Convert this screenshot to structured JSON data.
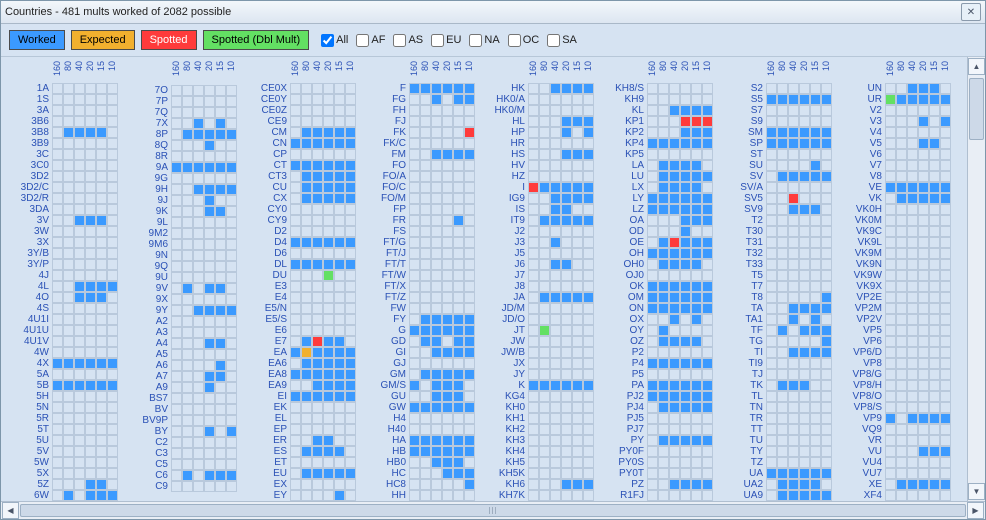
{
  "title": "Countries - 481 mults worked of 2082 possible",
  "legend": {
    "worked": "Worked",
    "expected": "Expected",
    "spotted": "Spotted",
    "dblmult": "Spotted (Dbl Mult)"
  },
  "filters": [
    {
      "label": "All",
      "checked": true
    },
    {
      "label": "AF",
      "checked": false
    },
    {
      "label": "AS",
      "checked": false
    },
    {
      "label": "EU",
      "checked": false
    },
    {
      "label": "NA",
      "checked": false
    },
    {
      "label": "OC",
      "checked": false
    },
    {
      "label": "SA",
      "checked": false
    }
  ],
  "bands": [
    "160",
    "80",
    "40",
    "20",
    "15",
    "10"
  ],
  "columns": [
    [
      {
        "p": "1A",
        "c": "eeeeee"
      },
      {
        "p": "1S",
        "c": "eeeeee"
      },
      {
        "p": "3A",
        "c": "eeeeee"
      },
      {
        "p": "3B6",
        "c": "eeeeee"
      },
      {
        "p": "3B8",
        "c": "eWWWWe"
      },
      {
        "p": "3B9",
        "c": "eeeeee"
      },
      {
        "p": "3C",
        "c": "eeeeee"
      },
      {
        "p": "3C0",
        "c": "eeeeee"
      },
      {
        "p": "3D2",
        "c": "eeeeee"
      },
      {
        "p": "3D2/C",
        "c": "eeeeee"
      },
      {
        "p": "3D2/R",
        "c": "eeeeee"
      },
      {
        "p": "3DA",
        "c": "eeeeee"
      },
      {
        "p": "3V",
        "c": "eeWWWe"
      },
      {
        "p": "3W",
        "c": "eeeeee"
      },
      {
        "p": "3X",
        "c": "eeeeee"
      },
      {
        "p": "3Y/B",
        "c": "eeeeee"
      },
      {
        "p": "3Y/P",
        "c": "eeeeee"
      },
      {
        "p": "4J",
        "c": "eeeeee"
      },
      {
        "p": "4L",
        "c": "eeWWWW"
      },
      {
        "p": "4O",
        "c": "eeWWWe"
      },
      {
        "p": "4S",
        "c": "eeeeee"
      },
      {
        "p": "4U1I",
        "c": "eeeeee"
      },
      {
        "p": "4U1U",
        "c": "eeeeee"
      },
      {
        "p": "4U1V",
        "c": "eeeeee"
      },
      {
        "p": "4W",
        "c": "eeeeee"
      },
      {
        "p": "4X",
        "c": "WWWWWW"
      },
      {
        "p": "5A",
        "c": "eeeeee"
      },
      {
        "p": "5B",
        "c": "WWWWWW"
      },
      {
        "p": "5H",
        "c": "eeeeee"
      },
      {
        "p": "5N",
        "c": "eeeeee"
      },
      {
        "p": "5R",
        "c": "eeeeee"
      },
      {
        "p": "5T",
        "c": "eeeeee"
      },
      {
        "p": "5U",
        "c": "eeeeee"
      },
      {
        "p": "5V",
        "c": "eeeeee"
      },
      {
        "p": "5W",
        "c": "eeeeee"
      },
      {
        "p": "5X",
        "c": "eeeeee"
      },
      {
        "p": "5Z",
        "c": "eeeWWe"
      },
      {
        "p": "6W",
        "c": "eWeWWW"
      }
    ],
    [
      {
        "p": "7O",
        "c": "eeeeee"
      },
      {
        "p": "7P",
        "c": "eeeeee"
      },
      {
        "p": "7Q",
        "c": "eeeeee"
      },
      {
        "p": "7X",
        "c": "eeWeWe"
      },
      {
        "p": "8P",
        "c": "eWWWWW"
      },
      {
        "p": "8Q",
        "c": "eeeWee"
      },
      {
        "p": "8R",
        "c": "eeeeee"
      },
      {
        "p": "9A",
        "c": "WWWWWW"
      },
      {
        "p": "9G",
        "c": "eeeeee"
      },
      {
        "p": "9H",
        "c": "eeWWWW"
      },
      {
        "p": "9J",
        "c": "eeeWee"
      },
      {
        "p": "9K",
        "c": "eeeWWe"
      },
      {
        "p": "9L",
        "c": "eeeeee"
      },
      {
        "p": "9M2",
        "c": "eeeeee"
      },
      {
        "p": "9M6",
        "c": "eeeeee"
      },
      {
        "p": "9N",
        "c": "eeeeee"
      },
      {
        "p": "9Q",
        "c": "eeeeee"
      },
      {
        "p": "9U",
        "c": "eeeeee"
      },
      {
        "p": "9V",
        "c": "eWeWWe"
      },
      {
        "p": "9X",
        "c": "eeeeee"
      },
      {
        "p": "9Y",
        "c": "eeWWWW"
      },
      {
        "p": "A2",
        "c": "eeeeee"
      },
      {
        "p": "A3",
        "c": "eeeeee"
      },
      {
        "p": "A4",
        "c": "eeeWWe"
      },
      {
        "p": "A5",
        "c": "eeeeee"
      },
      {
        "p": "A6",
        "c": "eeeeWe"
      },
      {
        "p": "A7",
        "c": "eeeWWe"
      },
      {
        "p": "A9",
        "c": "eeeWee"
      },
      {
        "p": "BS7",
        "c": "eeeeee"
      },
      {
        "p": "BV",
        "c": "eeeeee"
      },
      {
        "p": "BV9P",
        "c": "eeeeee"
      },
      {
        "p": "BY",
        "c": "eeeWeW"
      },
      {
        "p": "C2",
        "c": "eeeeee"
      },
      {
        "p": "C3",
        "c": "eeeeee"
      },
      {
        "p": "C5",
        "c": "eeeeee"
      },
      {
        "p": "C6",
        "c": "eWeWWW"
      },
      {
        "p": "C9",
        "c": "eeeeee"
      }
    ],
    [
      {
        "p": "CE0X",
        "c": "eeeeee"
      },
      {
        "p": "CE0Y",
        "c": "eeeeee"
      },
      {
        "p": "CE0Z",
        "c": "eeeeee"
      },
      {
        "p": "CE9",
        "c": "eeeeee"
      },
      {
        "p": "CM",
        "c": "eWWWWW"
      },
      {
        "p": "CN",
        "c": "WWWWWW"
      },
      {
        "p": "CP",
        "c": "eeeeee"
      },
      {
        "p": "CT",
        "c": "WWWWWW"
      },
      {
        "p": "CT3",
        "c": "eWWWWW"
      },
      {
        "p": "CU",
        "c": "eWWWWW"
      },
      {
        "p": "CX",
        "c": "eWWWWW"
      },
      {
        "p": "CY0",
        "c": "eeeeee"
      },
      {
        "p": "CY9",
        "c": "eeeeee"
      },
      {
        "p": "D2",
        "c": "eeeeee"
      },
      {
        "p": "D4",
        "c": "WWWWWW"
      },
      {
        "p": "D6",
        "c": "eeeeee"
      },
      {
        "p": "DL",
        "c": "WWWWWW"
      },
      {
        "p": "DU",
        "c": "eeeDee"
      },
      {
        "p": "E3",
        "c": "eeeeee"
      },
      {
        "p": "E4",
        "c": "eeeeee"
      },
      {
        "p": "E5/N",
        "c": "eeeeee"
      },
      {
        "p": "E5/S",
        "c": "eeeeee"
      },
      {
        "p": "E6",
        "c": "eeeeee"
      },
      {
        "p": "E7",
        "c": "eWSWWe"
      },
      {
        "p": "EA",
        "c": "WXWWWW"
      },
      {
        "p": "EA6",
        "c": "eWWWWW"
      },
      {
        "p": "EA8",
        "c": "WWWWWW"
      },
      {
        "p": "EA9",
        "c": "eeWWWW"
      },
      {
        "p": "EI",
        "c": "WWWWWW"
      },
      {
        "p": "EK",
        "c": "eeeeee"
      },
      {
        "p": "EL",
        "c": "eeeeee"
      },
      {
        "p": "EP",
        "c": "eeeeee"
      },
      {
        "p": "ER",
        "c": "eeWWee"
      },
      {
        "p": "ES",
        "c": "eWWWWe"
      },
      {
        "p": "ET",
        "c": "eeeeee"
      },
      {
        "p": "EU",
        "c": "eWWWWW"
      },
      {
        "p": "EX",
        "c": "eeeeee"
      },
      {
        "p": "EY",
        "c": "eeeeWe"
      }
    ],
    [
      {
        "p": "F",
        "c": "WWWWWW"
      },
      {
        "p": "FG",
        "c": "eeWeWW"
      },
      {
        "p": "FH",
        "c": "eeeeee"
      },
      {
        "p": "FJ",
        "c": "eeeeee"
      },
      {
        "p": "FK",
        "c": "eeeeeS"
      },
      {
        "p": "FK/C",
        "c": "eeeeee"
      },
      {
        "p": "FM",
        "c": "eeWWWW"
      },
      {
        "p": "FO",
        "c": "eeeeee"
      },
      {
        "p": "FO/A",
        "c": "eeeeee"
      },
      {
        "p": "FO/C",
        "c": "eeeeee"
      },
      {
        "p": "FO/M",
        "c": "eeeeee"
      },
      {
        "p": "FP",
        "c": "eeeeee"
      },
      {
        "p": "FR",
        "c": "eeeeWe"
      },
      {
        "p": "FS",
        "c": "eeeeee"
      },
      {
        "p": "FT/G",
        "c": "eeeeee"
      },
      {
        "p": "FT/J",
        "c": "eeeeee"
      },
      {
        "p": "FT/T",
        "c": "eeeeee"
      },
      {
        "p": "FT/W",
        "c": "eeeeee"
      },
      {
        "p": "FT/X",
        "c": "eeeeee"
      },
      {
        "p": "FT/Z",
        "c": "eeeeee"
      },
      {
        "p": "FW",
        "c": "eeeeee"
      },
      {
        "p": "FY",
        "c": "eWWWWW"
      },
      {
        "p": "G",
        "c": "WWWWWW"
      },
      {
        "p": "GD",
        "c": "eWWeWW"
      },
      {
        "p": "GI",
        "c": "eeWWWW"
      },
      {
        "p": "GJ",
        "c": "eeeeee"
      },
      {
        "p": "GM",
        "c": "eWWWWW"
      },
      {
        "p": "GM/S",
        "c": "WeWWWe"
      },
      {
        "p": "GU",
        "c": "eeWWWe"
      },
      {
        "p": "GW",
        "c": "WWWWWW"
      },
      {
        "p": "H4",
        "c": "eeeeee"
      },
      {
        "p": "H40",
        "c": "eeeeee"
      },
      {
        "p": "HA",
        "c": "WWWWWW"
      },
      {
        "p": "HB",
        "c": "WWWWWW"
      },
      {
        "p": "HB0",
        "c": "eeWWWe"
      },
      {
        "p": "HC",
        "c": "eeeWWW"
      },
      {
        "p": "HC8",
        "c": "eeeeeW"
      },
      {
        "p": "HH",
        "c": "eeeeee"
      }
    ],
    [
      {
        "p": "HK",
        "c": "eeWWWW"
      },
      {
        "p": "HK0/A",
        "c": "eeeeee"
      },
      {
        "p": "HK0/M",
        "c": "eeeeee"
      },
      {
        "p": "HL",
        "c": "eeeWWW"
      },
      {
        "p": "HP",
        "c": "eeeWeW"
      },
      {
        "p": "HR",
        "c": "eeeeee"
      },
      {
        "p": "HS",
        "c": "eeeWWW"
      },
      {
        "p": "HV",
        "c": "eeeeee"
      },
      {
        "p": "HZ",
        "c": "eeeeee"
      },
      {
        "p": "I",
        "c": "SWWWWW"
      },
      {
        "p": "IG9",
        "c": "eeWWWW"
      },
      {
        "p": "IS",
        "c": "eeWWee"
      },
      {
        "p": "IT9",
        "c": "eWWWWW"
      },
      {
        "p": "J2",
        "c": "eeeeee"
      },
      {
        "p": "J3",
        "c": "eeWeee"
      },
      {
        "p": "J5",
        "c": "eeeeee"
      },
      {
        "p": "J6",
        "c": "eeWWee"
      },
      {
        "p": "J7",
        "c": "eeeeee"
      },
      {
        "p": "J8",
        "c": "eeeeee"
      },
      {
        "p": "JA",
        "c": "eWWWWW"
      },
      {
        "p": "JD/M",
        "c": "eeeeee"
      },
      {
        "p": "JD/O",
        "c": "eeeeee"
      },
      {
        "p": "JT",
        "c": "eDeeee"
      },
      {
        "p": "JW",
        "c": "eeeeee"
      },
      {
        "p": "JW/B",
        "c": "eeeeee"
      },
      {
        "p": "JX",
        "c": "eeeeee"
      },
      {
        "p": "JY",
        "c": "eeeeee"
      },
      {
        "p": "K",
        "c": "WWWWWW"
      },
      {
        "p": "KG4",
        "c": "eeeeee"
      },
      {
        "p": "KH0",
        "c": "eeeeee"
      },
      {
        "p": "KH1",
        "c": "eeeeee"
      },
      {
        "p": "KH2",
        "c": "eeeeee"
      },
      {
        "p": "KH3",
        "c": "eeeeee"
      },
      {
        "p": "KH4",
        "c": "eeeeee"
      },
      {
        "p": "KH5",
        "c": "eeeeee"
      },
      {
        "p": "KH5K",
        "c": "eeeeee"
      },
      {
        "p": "KH6",
        "c": "eeeWWW"
      },
      {
        "p": "KH7K",
        "c": "eeeeee"
      }
    ],
    [
      {
        "p": "KH8/S",
        "c": "eeeeee"
      },
      {
        "p": "KH9",
        "c": "eeeeee"
      },
      {
        "p": "KL",
        "c": "eeWWWW"
      },
      {
        "p": "KP1",
        "c": "eeeSSS"
      },
      {
        "p": "KP2",
        "c": "eeeWWW"
      },
      {
        "p": "KP4",
        "c": "WWWWWW"
      },
      {
        "p": "KP5",
        "c": "eeeeee"
      },
      {
        "p": "LA",
        "c": "eWWWWe"
      },
      {
        "p": "LU",
        "c": "eWWWWW"
      },
      {
        "p": "LX",
        "c": "eWWWWe"
      },
      {
        "p": "LY",
        "c": "WWWWWW"
      },
      {
        "p": "LZ",
        "c": "WWWWWW"
      },
      {
        "p": "OA",
        "c": "eeeWWW"
      },
      {
        "p": "OD",
        "c": "eeeWee"
      },
      {
        "p": "OE",
        "c": "eWSWWW"
      },
      {
        "p": "OH",
        "c": "WWWWWW"
      },
      {
        "p": "OH0",
        "c": "eWWWWe"
      },
      {
        "p": "OJ0",
        "c": "eeeeee"
      },
      {
        "p": "OK",
        "c": "WWWWWW"
      },
      {
        "p": "OM",
        "c": "WWWWWW"
      },
      {
        "p": "ON",
        "c": "WWWWWW"
      },
      {
        "p": "OX",
        "c": "eeWeWe"
      },
      {
        "p": "OY",
        "c": "eWeeee"
      },
      {
        "p": "OZ",
        "c": "eWWWWe"
      },
      {
        "p": "P2",
        "c": "eeeeee"
      },
      {
        "p": "P4",
        "c": "WWWWWW"
      },
      {
        "p": "P5",
        "c": "eeeeee"
      },
      {
        "p": "PA",
        "c": "WWWWWW"
      },
      {
        "p": "PJ2",
        "c": "WWWWWW"
      },
      {
        "p": "PJ4",
        "c": "eWWWWW"
      },
      {
        "p": "PJ5",
        "c": "eeeeee"
      },
      {
        "p": "PJ7",
        "c": "eeeeee"
      },
      {
        "p": "PY",
        "c": "eWWWWW"
      },
      {
        "p": "PY0F",
        "c": "eeeeee"
      },
      {
        "p": "PY0S",
        "c": "eeeeee"
      },
      {
        "p": "PY0T",
        "c": "eeeeee"
      },
      {
        "p": "PZ",
        "c": "eeWWWW"
      },
      {
        "p": "R1FJ",
        "c": "eeeeee"
      }
    ],
    [
      {
        "p": "S2",
        "c": "eeeeee"
      },
      {
        "p": "S5",
        "c": "WWWWWW"
      },
      {
        "p": "S7",
        "c": "eeeeee"
      },
      {
        "p": "S9",
        "c": "eeeeee"
      },
      {
        "p": "SM",
        "c": "WWWWWW"
      },
      {
        "p": "SP",
        "c": "WWWWWW"
      },
      {
        "p": "ST",
        "c": "eeeeee"
      },
      {
        "p": "SU",
        "c": "eeeeWe"
      },
      {
        "p": "SV",
        "c": "eWWWWW"
      },
      {
        "p": "SV/A",
        "c": "eeeeee"
      },
      {
        "p": "SV5",
        "c": "eeSeee"
      },
      {
        "p": "SV9",
        "c": "eeWWWe"
      },
      {
        "p": "T2",
        "c": "eeeeee"
      },
      {
        "p": "T30",
        "c": "eeeeee"
      },
      {
        "p": "T31",
        "c": "eeeeee"
      },
      {
        "p": "T32",
        "c": "eeeeee"
      },
      {
        "p": "T33",
        "c": "eeeeee"
      },
      {
        "p": "T5",
        "c": "eeeeee"
      },
      {
        "p": "T7",
        "c": "eeeeee"
      },
      {
        "p": "T8",
        "c": "eeeeeW"
      },
      {
        "p": "TA",
        "c": "eeWWWW"
      },
      {
        "p": "TA1",
        "c": "eeWeWe"
      },
      {
        "p": "TF",
        "c": "eWeWWW"
      },
      {
        "p": "TG",
        "c": "eeeeeW"
      },
      {
        "p": "TI",
        "c": "eeWWWW"
      },
      {
        "p": "TI9",
        "c": "eeeeee"
      },
      {
        "p": "TJ",
        "c": "eeeeee"
      },
      {
        "p": "TK",
        "c": "eWWWee"
      },
      {
        "p": "TL",
        "c": "eeeeee"
      },
      {
        "p": "TN",
        "c": "eeeeee"
      },
      {
        "p": "TR",
        "c": "eeeeee"
      },
      {
        "p": "TT",
        "c": "eeeeee"
      },
      {
        "p": "TU",
        "c": "eeeeee"
      },
      {
        "p": "TY",
        "c": "eeeeee"
      },
      {
        "p": "TZ",
        "c": "eeeeee"
      },
      {
        "p": "UA",
        "c": "WWWWWW"
      },
      {
        "p": "UA2",
        "c": "eWWWWe"
      },
      {
        "p": "UA9",
        "c": "eWWWWW"
      }
    ],
    [
      {
        "p": "UN",
        "c": "eeWWWe"
      },
      {
        "p": "UR",
        "c": "DWWWWW"
      },
      {
        "p": "V2",
        "c": "eeeeee"
      },
      {
        "p": "V3",
        "c": "eeeWeW"
      },
      {
        "p": "V4",
        "c": "eeeeee"
      },
      {
        "p": "V5",
        "c": "eeeWWe"
      },
      {
        "p": "V6",
        "c": "eeeeee"
      },
      {
        "p": "V7",
        "c": "eeeeee"
      },
      {
        "p": "V8",
        "c": "eeeeee"
      },
      {
        "p": "VE",
        "c": "WWWWWW"
      },
      {
        "p": "VK",
        "c": "eWWWWW"
      },
      {
        "p": "VK0H",
        "c": "eeeeee"
      },
      {
        "p": "VK0M",
        "c": "eeeeee"
      },
      {
        "p": "VK9C",
        "c": "eeeeee"
      },
      {
        "p": "VK9L",
        "c": "eeeeee"
      },
      {
        "p": "VK9M",
        "c": "eeeeee"
      },
      {
        "p": "VK9N",
        "c": "eeeeee"
      },
      {
        "p": "VK9W",
        "c": "eeeeee"
      },
      {
        "p": "VK9X",
        "c": "eeeeee"
      },
      {
        "p": "VP2E",
        "c": "eeeeee"
      },
      {
        "p": "VP2M",
        "c": "eeeeee"
      },
      {
        "p": "VP2V",
        "c": "eeeeee"
      },
      {
        "p": "VP5",
        "c": "eeeeee"
      },
      {
        "p": "VP6",
        "c": "eeeeee"
      },
      {
        "p": "VP6/D",
        "c": "eeeeee"
      },
      {
        "p": "VP8",
        "c": "eeeeee"
      },
      {
        "p": "VP8/G",
        "c": "eeeeee"
      },
      {
        "p": "VP8/H",
        "c": "eeeeee"
      },
      {
        "p": "VP8/O",
        "c": "eeeeee"
      },
      {
        "p": "VP8/S",
        "c": "eeeeee"
      },
      {
        "p": "VP9",
        "c": "WeWWWW"
      },
      {
        "p": "VQ9",
        "c": "eeeeee"
      },
      {
        "p": "VR",
        "c": "eeeeee"
      },
      {
        "p": "VU",
        "c": "eeeWWW"
      },
      {
        "p": "VU4",
        "c": "eeeeee"
      },
      {
        "p": "VU7",
        "c": "eeeeee"
      },
      {
        "p": "XE",
        "c": "eWWWWW"
      },
      {
        "p": "XF4",
        "c": "eeeeee"
      }
    ]
  ]
}
